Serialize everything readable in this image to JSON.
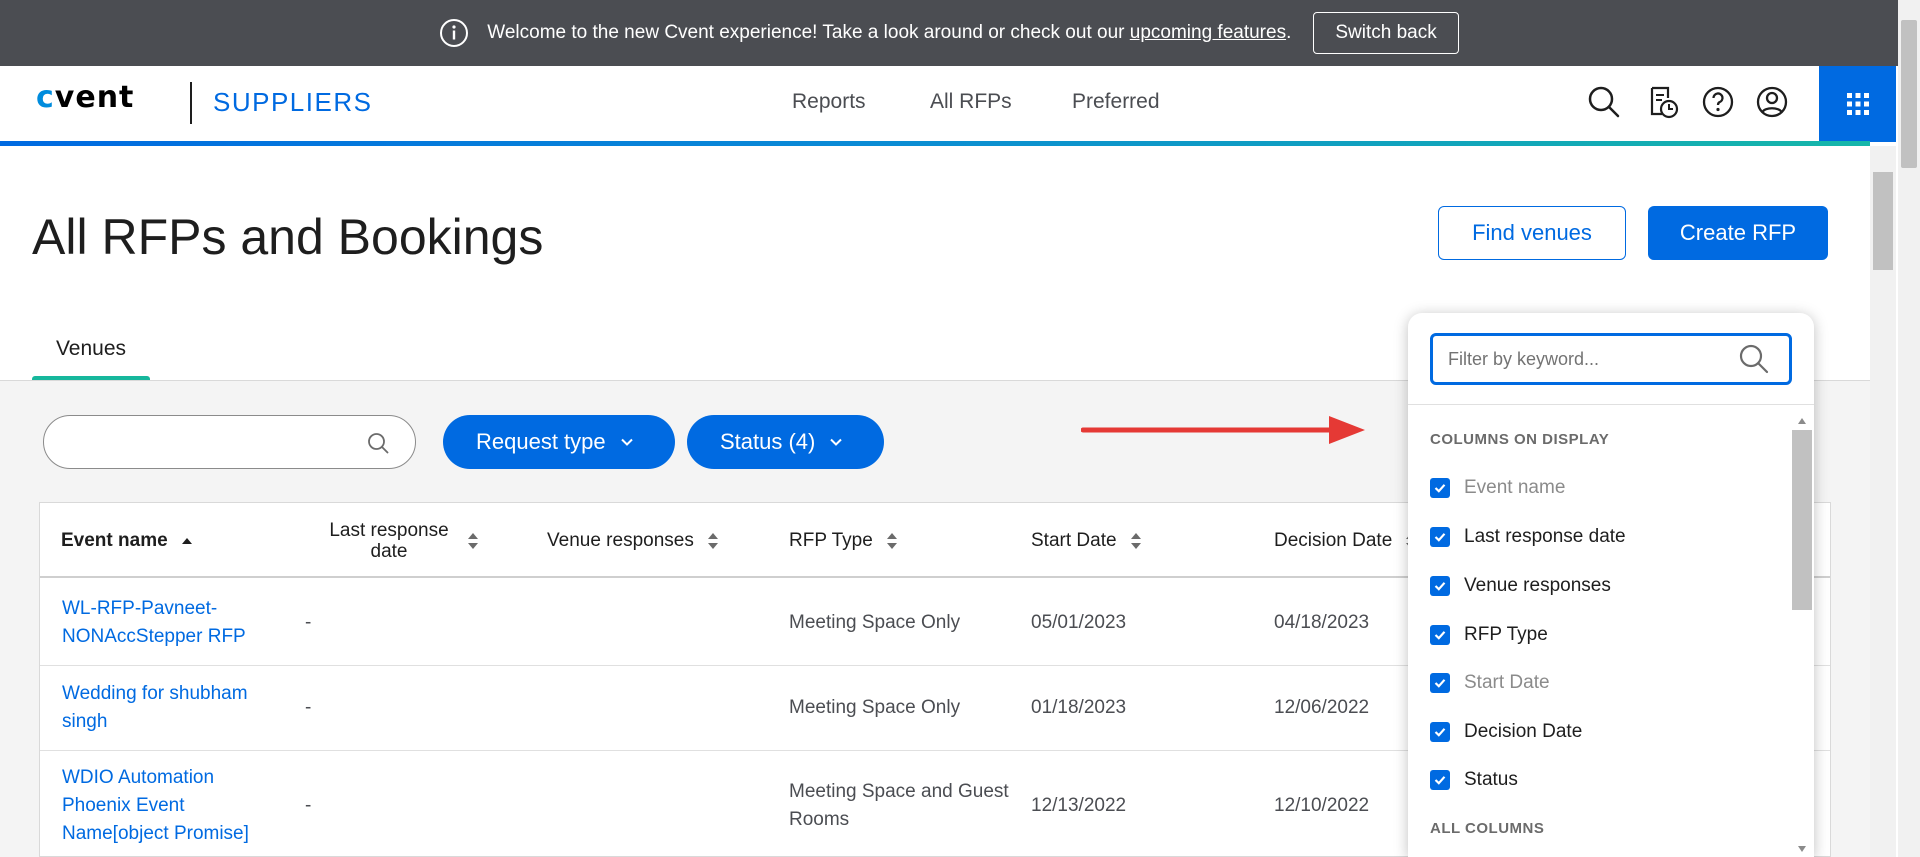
{
  "banner": {
    "text_before": "Welcome to the new Cvent experience! Take a look around or check out our ",
    "link": "upcoming features",
    "text_after": ".",
    "switch_back": "Switch back"
  },
  "header": {
    "logo": "cvent",
    "product": "SUPPLIERS",
    "nav": [
      "Reports",
      "All RFPs",
      "Preferred"
    ],
    "icons": [
      "search-icon",
      "report-schedule-icon",
      "help-icon",
      "user-icon",
      "apps-grid-icon"
    ]
  },
  "page": {
    "title": "All RFPs and Bookings",
    "find_venues": "Find venues",
    "create_rfp": "Create RFP",
    "tab": "Venues"
  },
  "filters": {
    "request_type": "Request type",
    "status": "Status (4)"
  },
  "table": {
    "headers": [
      "Event name",
      "Last response date",
      "Venue responses",
      "RFP Type",
      "Start Date",
      "Decision Date"
    ],
    "rows": [
      {
        "event_line1": "WL-RFP-Pavneet-",
        "event_line2": "NONAccStepper RFP",
        "event_line3": "",
        "last_response": "-",
        "venue_responses": "",
        "rfp_type_line1": "Meeting Space Only",
        "rfp_type_line2": "",
        "start_date": "05/01/2023",
        "decision_date": "04/18/2023"
      },
      {
        "event_line1": "Wedding for shubham",
        "event_line2": "singh",
        "event_line3": "",
        "last_response": "-",
        "venue_responses": "",
        "rfp_type_line1": "Meeting Space Only",
        "rfp_type_line2": "",
        "start_date": "01/18/2023",
        "decision_date": "12/06/2022"
      },
      {
        "event_line1": "WDIO Automation",
        "event_line2": "Phoenix Event",
        "event_line3": "Name[object Promise]",
        "last_response": "-",
        "venue_responses": "",
        "rfp_type_line1": "Meeting Space and Guest",
        "rfp_type_line2": "Rooms",
        "start_date": "12/13/2022",
        "decision_date": "12/10/2022"
      }
    ]
  },
  "column_picker": {
    "placeholder": "Filter by keyword...",
    "section_on_display": "COLUMNS ON DISPLAY",
    "items": [
      {
        "label": "Event name",
        "checked": true,
        "muted": true
      },
      {
        "label": "Last response date",
        "checked": true,
        "muted": false
      },
      {
        "label": "Venue responses",
        "checked": true,
        "muted": false
      },
      {
        "label": "RFP Type",
        "checked": true,
        "muted": false
      },
      {
        "label": "Start Date",
        "checked": true,
        "muted": true
      },
      {
        "label": "Decision Date",
        "checked": true,
        "muted": false
      },
      {
        "label": "Status",
        "checked": true,
        "muted": false
      }
    ],
    "section_all": "ALL COLUMNS"
  },
  "colors": {
    "primary": "#006ae1",
    "banner_bg": "#4b4d52",
    "tab_accent": "#16b79c",
    "annotation_arrow": "#e53935"
  }
}
